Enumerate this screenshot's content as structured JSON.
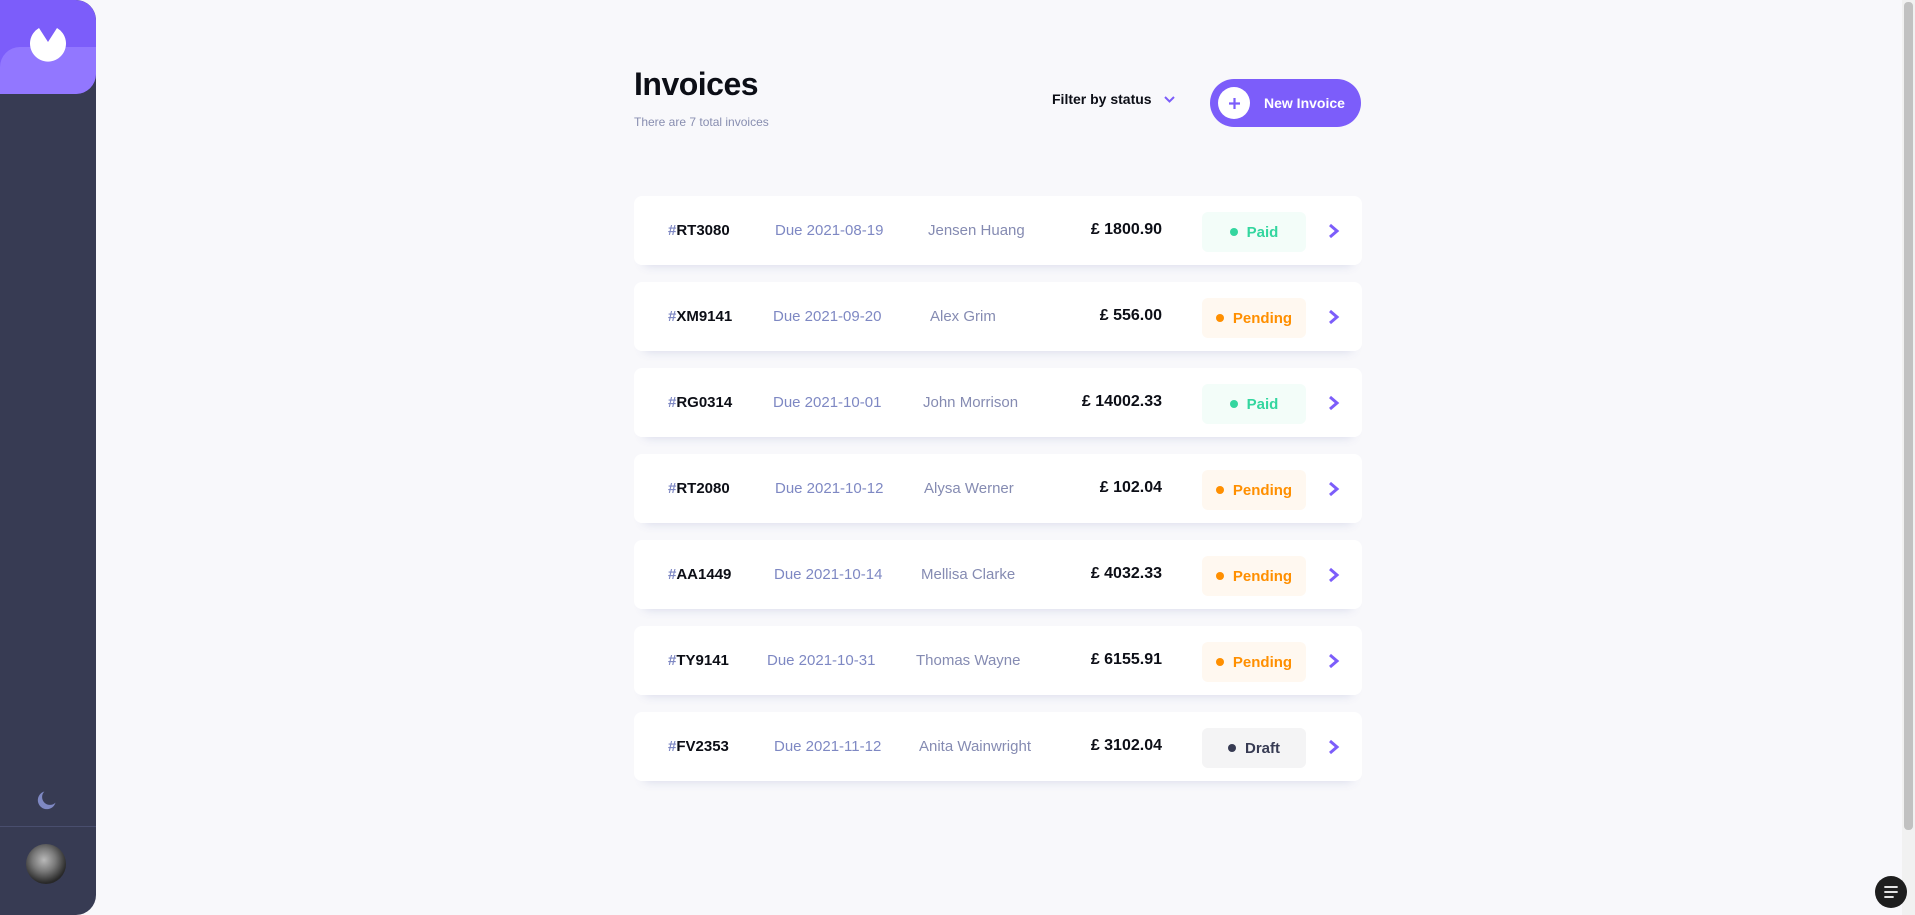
{
  "header": {
    "title": "Invoices",
    "subtitle": "There are 7 total invoices",
    "filter_label": "Filter by status",
    "new_invoice_label": "New Invoice"
  },
  "invoices": [
    {
      "hash": "#",
      "id": "RT3080",
      "due": "Due 2021-08-19",
      "client": "Jensen Huang",
      "amount": "£ 1800.90",
      "status": "Paid"
    },
    {
      "hash": "#",
      "id": "XM9141",
      "due": "Due 2021-09-20",
      "client": "Alex Grim",
      "amount": "£ 556.00",
      "status": "Pending"
    },
    {
      "hash": "#",
      "id": "RG0314",
      "due": "Due 2021-10-01",
      "client": "John Morrison",
      "amount": "£ 14002.33",
      "status": "Paid"
    },
    {
      "hash": "#",
      "id": "RT2080",
      "due": "Due 2021-10-12",
      "client": "Alysa Werner",
      "amount": "£ 102.04",
      "status": "Pending"
    },
    {
      "hash": "#",
      "id": "AA1449",
      "due": "Due 2021-10-14",
      "client": "Mellisa Clarke",
      "amount": "£ 4032.33",
      "status": "Pending"
    },
    {
      "hash": "#",
      "id": "TY9141",
      "due": "Due 2021-10-31",
      "client": "Thomas Wayne",
      "amount": "£ 6155.91",
      "status": "Pending"
    },
    {
      "hash": "#",
      "id": "FV2353",
      "due": "Due 2021-11-12",
      "client": "Anita Wainwright",
      "amount": "£ 3102.04",
      "status": "Draft"
    }
  ],
  "colors": {
    "accent": "#7c5dfa",
    "sidebar": "#373b53",
    "paid": "#33d69f",
    "pending": "#ff8f00",
    "draft": "#373b53"
  },
  "icons": {
    "logo": "logo-icon",
    "theme_toggle": "moon-icon",
    "filter": "chevron-down-icon",
    "new_invoice": "plus-icon",
    "row": "chevron-right-icon",
    "corner": "menu-icon"
  }
}
